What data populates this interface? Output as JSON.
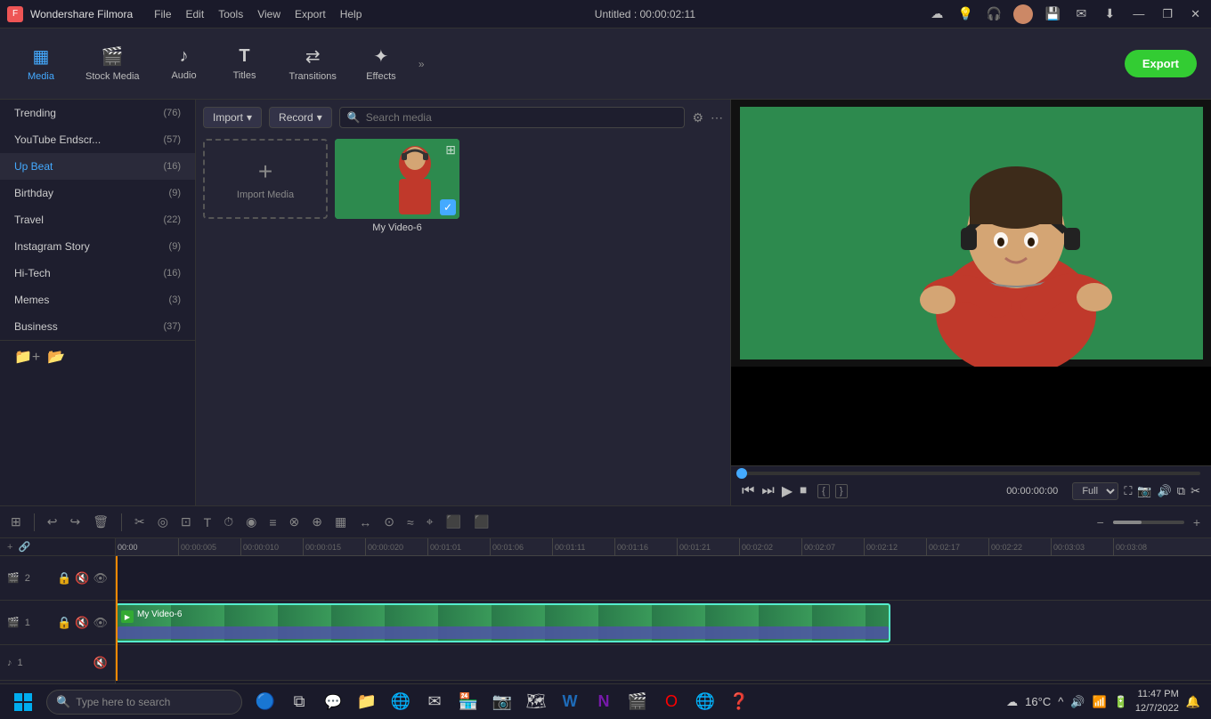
{
  "app": {
    "name": "Wondershare Filmora",
    "logo": "F",
    "title": "Untitled : 00:00:02:11"
  },
  "titlebar": {
    "menu": [
      "File",
      "Edit",
      "Tools",
      "View",
      "Export",
      "Help"
    ],
    "window_controls": [
      "—",
      "❐",
      "✕"
    ]
  },
  "toolbar": {
    "items": [
      {
        "id": "media",
        "icon": "▦",
        "label": "Media",
        "active": true
      },
      {
        "id": "stock",
        "icon": "🎬",
        "label": "Stock Media"
      },
      {
        "id": "audio",
        "icon": "♪",
        "label": "Audio"
      },
      {
        "id": "titles",
        "icon": "T",
        "label": "Titles"
      },
      {
        "id": "transitions",
        "icon": "⇄",
        "label": "Transitions"
      },
      {
        "id": "effects",
        "icon": "✦",
        "label": "Effects"
      }
    ],
    "export_label": "Export",
    "expand_icon": "»"
  },
  "sidebar": {
    "items": [
      {
        "name": "Trending",
        "count": 76
      },
      {
        "name": "YouTube Endscr...",
        "count": 57
      },
      {
        "name": "Up Beat",
        "count": 16
      },
      {
        "name": "Birthday",
        "count": 9
      },
      {
        "name": "Travel",
        "count": 22
      },
      {
        "name": "Instagram Story",
        "count": 9
      },
      {
        "name": "Hi-Tech",
        "count": 16
      },
      {
        "name": "Memes",
        "count": 3
      },
      {
        "name": "Business",
        "count": 37
      }
    ],
    "footer_icons": [
      "📁",
      "📂"
    ]
  },
  "media_panel": {
    "import_label": "Import",
    "record_label": "Record",
    "search_placeholder": "Search media",
    "import_media_label": "Import Media",
    "import_plus": "+",
    "media_items": [
      {
        "name": "My Video-6",
        "checked": true
      }
    ]
  },
  "preview": {
    "time": "00:00:00:00",
    "duration": "00:00:02:11",
    "quality": "Full",
    "seek_pct": 0,
    "markers": [
      "{",
      "}"
    ],
    "buttons": [
      "⏮",
      "⏭",
      "▶",
      "⏹"
    ]
  },
  "timeline": {
    "toolbar_icons": [
      "⊞",
      "↩",
      "↪",
      "🗑",
      "✂",
      "◎",
      "⊡",
      "T+",
      "⏱",
      "◉",
      "≡",
      "⊗",
      "⊕",
      "▦",
      "↔",
      "⊙",
      "≈",
      "⌖",
      "⬛",
      "⬛"
    ],
    "zoom_level": 50,
    "tracks": [
      {
        "id": "v2",
        "label": "2",
        "type": "video",
        "icons": [
          "lock",
          "mute",
          "eye"
        ]
      },
      {
        "id": "v1",
        "label": "1",
        "type": "video",
        "clip": "My Video-6",
        "icons": [
          "lock",
          "mute",
          "eye"
        ]
      },
      {
        "id": "a1",
        "label": "1",
        "type": "audio",
        "icons": [
          "music",
          "mute"
        ]
      }
    ],
    "ruler_marks": [
      "00:00:000:05",
      "00:00:000:10",
      "00:00:000:15",
      "00:00:000:20",
      "00:00:001:01",
      "00:00:001:06",
      "00:00:001:11",
      "00:00:001:16",
      "00:00:001:21",
      "00:00:002:02",
      "00:00:002:07",
      "00:00:002:12",
      "00:00:002:17",
      "00:00:002:22",
      "00:00:003:03",
      "00:00:003:08"
    ]
  },
  "taskbar": {
    "search_placeholder": "Type here to search",
    "search_icon": "🔍",
    "apps": [
      {
        "name": "windows-store",
        "icon": "🪟"
      },
      {
        "name": "cortana",
        "icon": "🔵"
      },
      {
        "name": "task-view",
        "icon": "⧉"
      },
      {
        "name": "chat",
        "icon": "💬"
      },
      {
        "name": "explorer",
        "icon": "📁"
      },
      {
        "name": "mail",
        "icon": "✉"
      },
      {
        "name": "chrome",
        "icon": "🌐"
      },
      {
        "name": "instagram",
        "icon": "📷"
      },
      {
        "name": "maps",
        "icon": "🗺"
      },
      {
        "name": "word",
        "icon": "W"
      },
      {
        "name": "onenote",
        "icon": "N"
      },
      {
        "name": "another",
        "icon": "📋"
      },
      {
        "name": "filmora2",
        "icon": "🎬"
      },
      {
        "name": "edge",
        "icon": "🌐"
      },
      {
        "name": "opera",
        "icon": "O"
      },
      {
        "name": "browser2",
        "icon": "🔴"
      },
      {
        "name": "helper",
        "icon": "❓"
      }
    ],
    "sys_icons": [
      "^",
      "🔊",
      "📶",
      "🔋"
    ],
    "temperature": "16°C",
    "time": "11:47 PM",
    "date": "12/7/2022",
    "notification_icon": "🔔",
    "weather_icon": "☁"
  },
  "colors": {
    "accent": "#4af",
    "bg_dark": "#1a1a2a",
    "bg_mid": "#252535",
    "bg_panel": "#1e1e2e",
    "green_screen": "#3a8",
    "export_green": "#33cc33",
    "clip_color": "#4a8"
  }
}
